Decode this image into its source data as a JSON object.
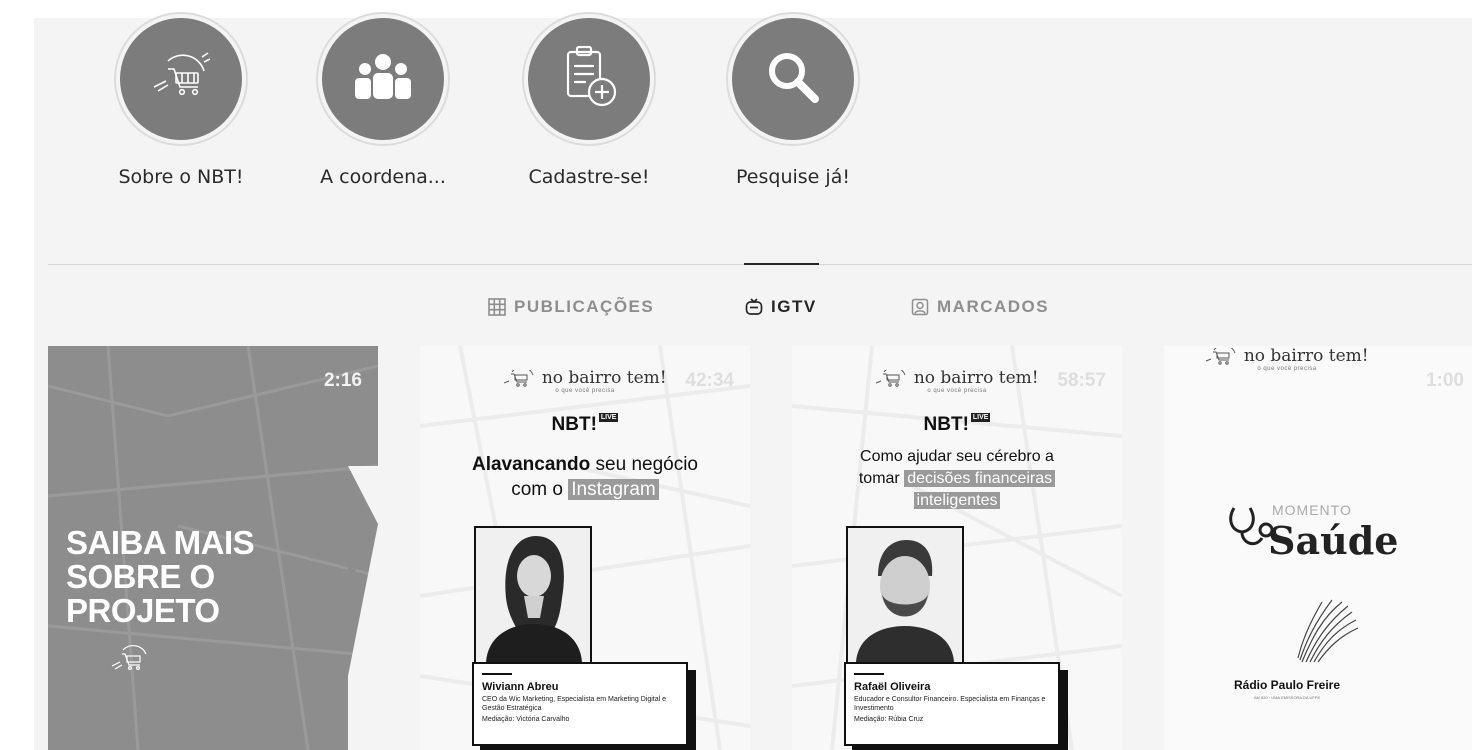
{
  "highlights": [
    {
      "label": "Sobre o NBT!",
      "icon": "cart-icon"
    },
    {
      "label": "A coordena...",
      "icon": "group-icon"
    },
    {
      "label": "Cadastre-se!",
      "icon": "clipboard-add-icon"
    },
    {
      "label": "Pesquise já!",
      "icon": "search-icon"
    }
  ],
  "tabs": [
    {
      "label": "PUBLICAÇÕES",
      "icon": "grid-icon",
      "active": false
    },
    {
      "label": "IGTV",
      "icon": "igtv-icon",
      "active": true
    },
    {
      "label": "MARCADOS",
      "icon": "tagged-icon",
      "active": false
    }
  ],
  "videos": [
    {
      "duration": "2:16",
      "headline": [
        "SAIBA MAIS",
        "SOBRE O",
        "PROJETO"
      ]
    },
    {
      "duration": "42:34",
      "brand": "no bairro tem!",
      "brand_sub": "o que você precisa",
      "series": "NBT!",
      "series_tag": "LIVE",
      "title_bold": "Alavancando",
      "title_rest": " seu negócio",
      "title_line2_pre": "com o ",
      "title_highlight": "Instagram",
      "speaker_name": "Wiviann Abreu",
      "speaker_role": "CEO da Wic Marketing, Especialista em Marketing Digital e Gestão Estratégica",
      "mediation": "Mediação: Victória Carvalho"
    },
    {
      "duration": "58:57",
      "brand": "no bairro tem!",
      "brand_sub": "o que você precisa",
      "series": "NBT!",
      "series_tag": "LIVE",
      "title_line1": "Como ajudar seu cérebro a",
      "title_line2_pre": "tomar ",
      "title_highlight": "decisões financeiras",
      "title_highlight2": "inteligentes",
      "speaker_name": "Rafaël Oliveira",
      "speaker_role": "Educador e Consultor Financeiro. Especialista em Finanças e Investimento",
      "mediation": "Mediação: Rúbia Cruz"
    },
    {
      "duration": "1:00",
      "brand": "no bairro tem!",
      "brand_sub": "o que você precisa",
      "segment_small": "MOMENTO",
      "segment_big": "Saúde",
      "station": "Rádio Paulo Freire",
      "station_sub": "AM 820 · UMA EMISSORA DA UFPE"
    }
  ],
  "colors": {
    "panel_bg": "#f4f4f4",
    "circle": "#7c7c7c",
    "active_tab": "#262626",
    "inactive_tab": "#8e8e8e"
  }
}
